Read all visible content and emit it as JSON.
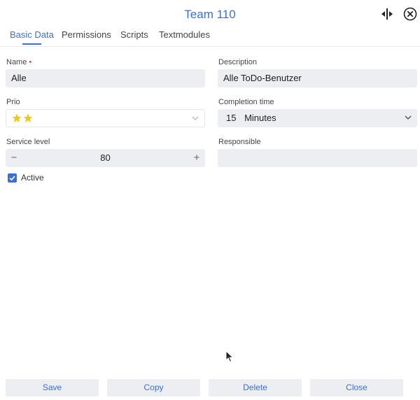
{
  "header": {
    "title": "Team 110",
    "icons": {
      "split": "split-view-icon",
      "close": "close-circle-icon"
    }
  },
  "tabs": [
    {
      "label": "Basic Data",
      "active": true
    },
    {
      "label": "Permissions",
      "active": false
    },
    {
      "label": "Scripts",
      "active": false
    },
    {
      "label": "Textmodules",
      "active": false
    }
  ],
  "form": {
    "name": {
      "label": "Name",
      "required_mark": "•",
      "value": "Alle"
    },
    "description": {
      "label": "Description",
      "value": "Alle ToDo-Benutzer"
    },
    "prio": {
      "label": "Prio",
      "stars": 2
    },
    "completion_time": {
      "label": "Completion time",
      "value": "15",
      "unit": "Minutes"
    },
    "service_level": {
      "label": "Service level",
      "value": "80",
      "minus": "−",
      "plus": "+"
    },
    "responsible": {
      "label": "Responsible",
      "value": ""
    },
    "active": {
      "label": "Active",
      "checked": true
    }
  },
  "buttons": {
    "save": "Save",
    "copy": "Copy",
    "delete": "Delete",
    "close": "Close"
  },
  "colors": {
    "accent": "#3b6fd8",
    "field_bg": "#eceef1",
    "star": "#f5c518",
    "required": "#e04040"
  }
}
